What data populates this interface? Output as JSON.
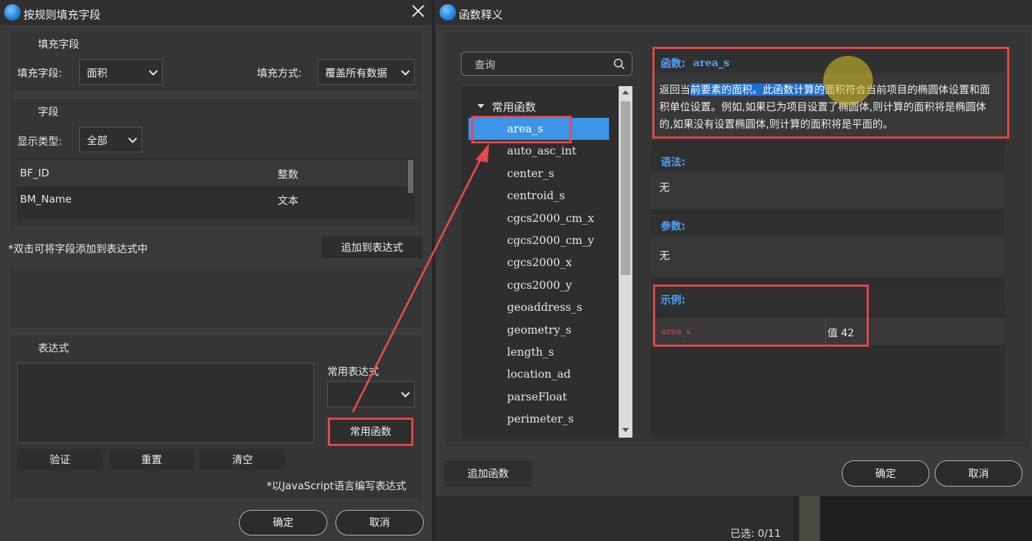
{
  "left": {
    "title": "按规则填充字段",
    "fill_group": {
      "title": "填充字段",
      "field_label": "填充字段:",
      "field_value": "面积",
      "mode_label": "填充方式:",
      "mode_value": "覆盖所有数据"
    },
    "field_group": {
      "title": "字段",
      "type_label": "显示类型:",
      "type_value": "全部",
      "rows": [
        {
          "name": "BF_ID",
          "type": "整数"
        },
        {
          "name": "BM_Name",
          "type": "文本"
        }
      ]
    },
    "hint": "*双击可将字段添加到表达式中",
    "add_to_expr": "追加到表达式",
    "expr_group": {
      "title": "表达式",
      "common_expr_label": "常用表达式",
      "common_func_btn": "常用函数",
      "validate": "验证",
      "reset": "重置",
      "clear": "清空",
      "js_note": "*以JavaScript语言编写表达式"
    },
    "ok": "确定",
    "cancel": "取消"
  },
  "right": {
    "title": "函数释义",
    "search_placeholder": "查询",
    "tree_root": "常用函数",
    "functions": [
      "area_s",
      "auto_asc_int",
      "center_s",
      "centroid_s",
      "cgcs2000_cm_x",
      "cgcs2000_cm_y",
      "cgcs2000_x",
      "cgcs2000_y",
      "geoaddress_s",
      "geometry_s",
      "length_s",
      "location_ad",
      "parseFloat",
      "perimeter_s"
    ],
    "selected_function": "area_s",
    "func_label": "函数:",
    "func_name": "area_s",
    "desc_pre": "返回当",
    "desc_hl": "前要素的面积。此函数计算的",
    "desc_post": "面积符合当前项目的椭圆体设置和面积单位设置。例如,如果已为项目设置了椭圆体,则计算的面积将是椭圆体的,如果没有设置椭圆体,则计算的面积将是平面的。",
    "syntax_label": "语法:",
    "syntax_value": "无",
    "params_label": "参数:",
    "params_value": "无",
    "example_label": "示例:",
    "example_expr": "area_s",
    "example_result": "值  42",
    "add_func": "追加函数",
    "ok": "确定",
    "cancel": "取消"
  },
  "status": {
    "selected": "已选: 0/11"
  },
  "colors": {
    "accent": "#3d95e8",
    "annotation_red": "#e8474c",
    "section_title": "#4da3ff",
    "example_text": "#e8474c"
  }
}
